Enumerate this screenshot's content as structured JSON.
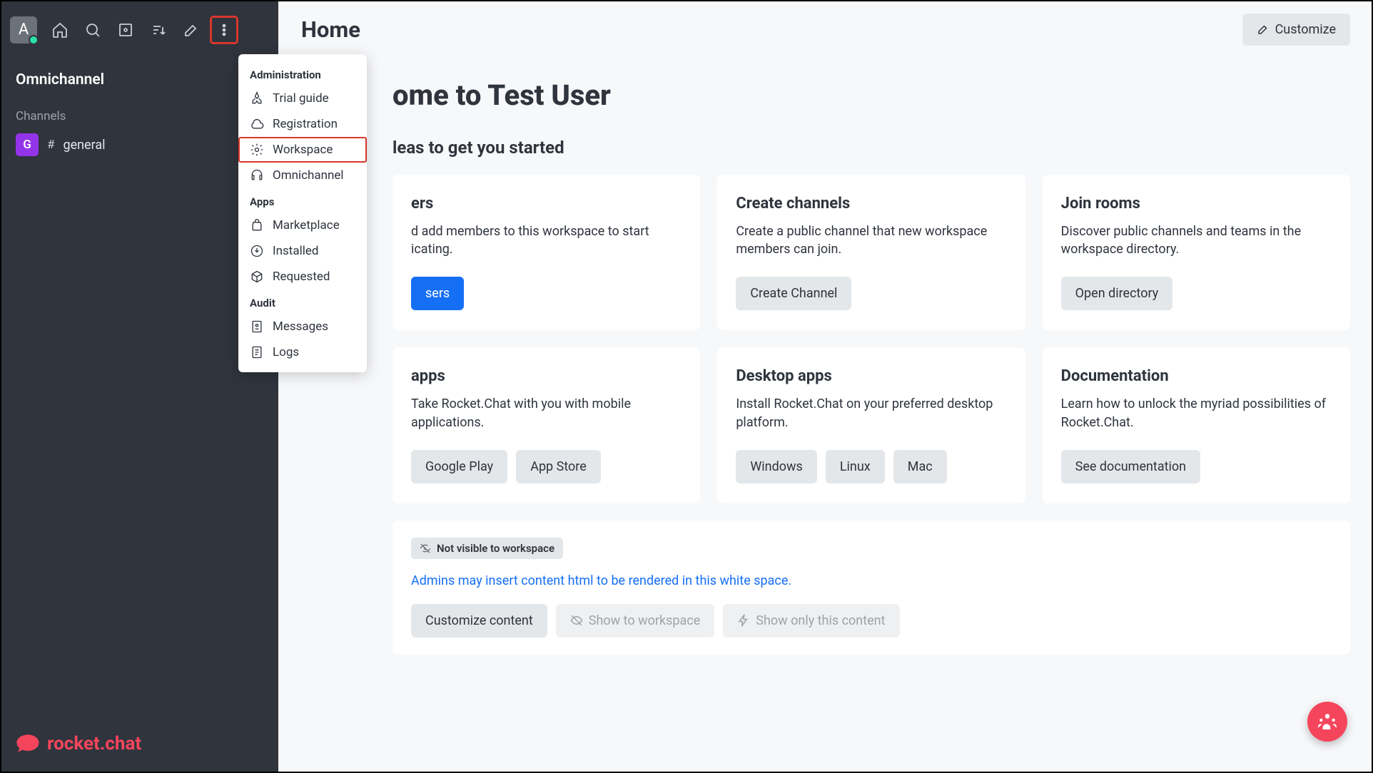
{
  "sidebar": {
    "avatar_initial": "A",
    "section": "Omnichannel",
    "channels_label": "Channels",
    "channels": [
      {
        "avatar": "G",
        "name": "general"
      }
    ],
    "brand": "rocket.chat"
  },
  "dropdown": {
    "groups": [
      {
        "label": "Administration",
        "items": [
          {
            "label": "Trial guide",
            "icon": "rocket"
          },
          {
            "label": "Registration",
            "icon": "cloud"
          },
          {
            "label": "Workspace",
            "icon": "gear",
            "highlighted": true
          },
          {
            "label": "Omnichannel",
            "icon": "headset"
          }
        ]
      },
      {
        "label": "Apps",
        "items": [
          {
            "label": "Marketplace",
            "icon": "bag"
          },
          {
            "label": "Installed",
            "icon": "download-circle"
          },
          {
            "label": "Requested",
            "icon": "cube"
          }
        ]
      },
      {
        "label": "Audit",
        "items": [
          {
            "label": "Messages",
            "icon": "eye-doc"
          },
          {
            "label": "Logs",
            "icon": "log"
          }
        ]
      }
    ]
  },
  "header": {
    "title": "Home",
    "customize": "Customize"
  },
  "content": {
    "welcome_prefix": "ome to Test User",
    "subhead_cut": "leas to get you started",
    "cards": [
      {
        "title_cut": "ers",
        "desc_cut": "d add members to this workspace to start icating.",
        "buttons": [
          {
            "label_cut": "sers",
            "style": "primary"
          }
        ]
      },
      {
        "title": "Create channels",
        "desc": "Create a public channel that new workspace members can join.",
        "buttons": [
          {
            "label": "Create Channel"
          }
        ]
      },
      {
        "title": "Join rooms",
        "desc": "Discover public channels and teams in the workspace directory.",
        "buttons": [
          {
            "label": "Open directory"
          }
        ]
      },
      {
        "title_cut": "apps",
        "desc": "Take Rocket.Chat with you with mobile applications.",
        "buttons": [
          {
            "label": "Google Play"
          },
          {
            "label": "App Store"
          }
        ]
      },
      {
        "title": "Desktop apps",
        "desc": "Install Rocket.Chat on your preferred desktop platform.",
        "buttons": [
          {
            "label": "Windows"
          },
          {
            "label": "Linux"
          },
          {
            "label": "Mac"
          }
        ]
      },
      {
        "title": "Documentation",
        "desc": "Learn how to unlock the myriad possibilities of Rocket.Chat.",
        "buttons": [
          {
            "label": "See documentation"
          }
        ]
      }
    ],
    "badge": "Not visible to workspace",
    "admin_note": "Admins may insert content html to be rendered in this white space.",
    "bottom_buttons": [
      {
        "label": "Customize content",
        "style": ""
      },
      {
        "label": "Show to workspace",
        "style": "disabled",
        "icon": "eye-off"
      },
      {
        "label": "Show only this content",
        "style": "disabled",
        "icon": "bolt"
      }
    ]
  }
}
